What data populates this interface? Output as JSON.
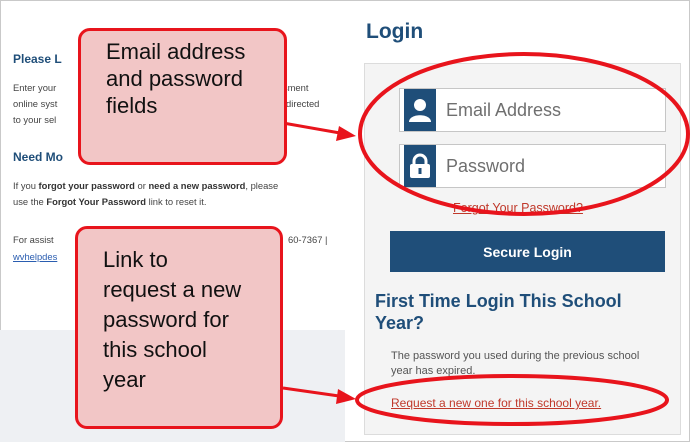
{
  "left": {
    "please_heading": "Please L",
    "para1": [
      "Enter your",
      "online syst",
      "to your sel"
    ],
    "para1_right": [
      "essment",
      "be directed"
    ],
    "need_heading": "Need Mo",
    "para2_prefix": "If you ",
    "para2_bold1": "forgot your password",
    "para2_mid": " or ",
    "para2_bold2": "need a new password",
    "para2_end": ", please",
    "para3_prefix": "use the ",
    "para3_bold": "Forgot Your Password",
    "para3_end": " link to reset it.",
    "assist_text": "For assist",
    "assist_phone": "60-7367 |",
    "helpdesk_link": "wvhelpdes"
  },
  "login": {
    "title": "Login",
    "email_placeholder": "Email Address",
    "password_placeholder": "Password",
    "forgot_link": "Forgot Your Password?",
    "secure_login": "Secure Login",
    "first_time_heading": "First Time Login This School Year?",
    "expired_text": "The password you used during the previous school year has expired.",
    "request_link": "Request a new one for this school year."
  },
  "callouts": {
    "top": [
      "Email address",
      "and password",
      "fields"
    ],
    "bottom": [
      "Link to",
      "request a new",
      "password for",
      "this school",
      "year"
    ]
  },
  "icons": {
    "email": "user-icon",
    "password": "lock-icon"
  },
  "colors": {
    "brand_blue": "#1f4e79",
    "annotation_red": "#e8141c",
    "callout_fill": "#f2c6c6",
    "link_red": "#c0392b"
  }
}
